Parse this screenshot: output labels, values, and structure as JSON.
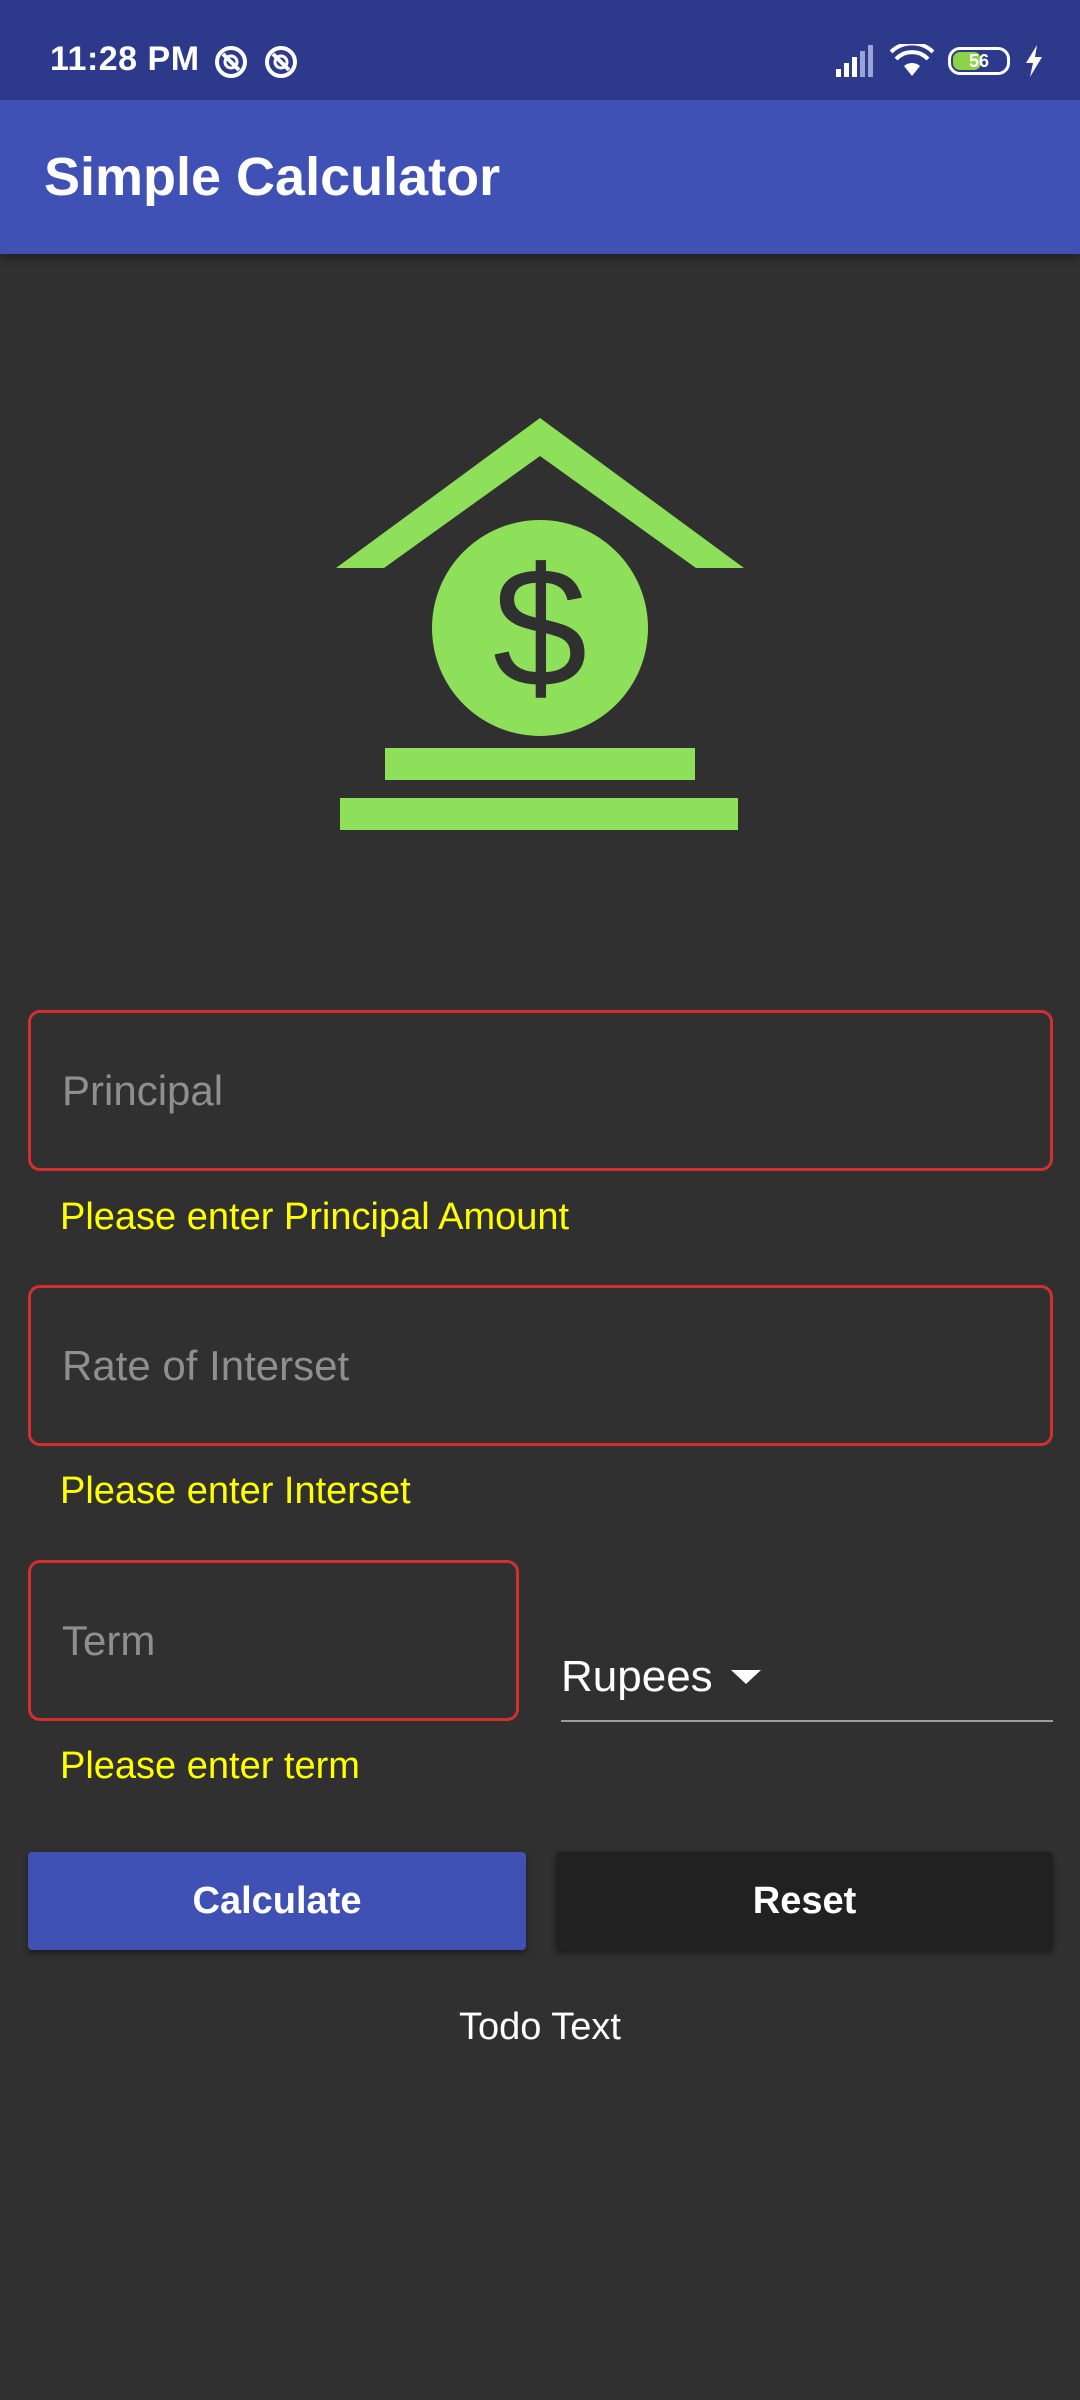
{
  "status_bar": {
    "time": "11:28 PM",
    "battery": "56",
    "icons": [
      "sync-icon",
      "sync-icon",
      "signal-icon",
      "wifi-icon",
      "battery-icon",
      "charging-icon"
    ]
  },
  "app_bar": {
    "title": "Simple Calculator"
  },
  "logo": {
    "icon": "house-dollar-icon",
    "color": "#8ee05a"
  },
  "form": {
    "principal": {
      "placeholder": "Principal",
      "value": "",
      "error": "Please enter Principal Amount"
    },
    "rate": {
      "placeholder": "Rate of Interset",
      "value": "",
      "error": "Please enter Interset"
    },
    "term": {
      "placeholder": "Term",
      "value": "",
      "error": "Please enter term"
    },
    "currency": {
      "selected": "Rupees"
    }
  },
  "buttons": {
    "calculate": "Calculate",
    "reset": "Reset"
  },
  "result": {
    "text": "Todo Text"
  },
  "colors": {
    "primary": "#3f51b5",
    "status_bar": "#2d3a8c",
    "background": "#303030",
    "error_border": "#d32f2f",
    "error_text": "#ffff00",
    "accent_green": "#8ee05a"
  }
}
